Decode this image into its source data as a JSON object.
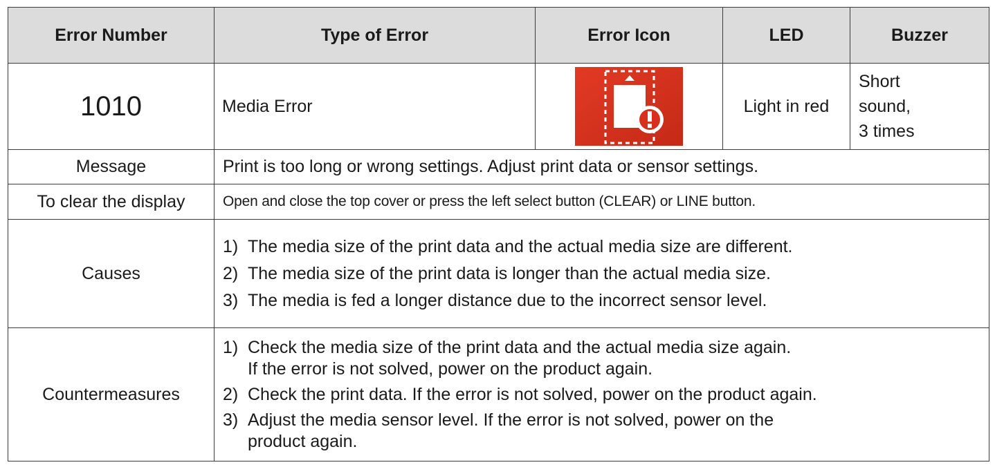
{
  "headers": {
    "error_number": "Error Number",
    "type_of_error": "Type of Error",
    "error_icon": "Error Icon",
    "led": "LED",
    "buzzer": "Buzzer"
  },
  "error": {
    "number": "1010",
    "type": "Media Error",
    "icon": "media-error-icon",
    "led": "Light in red",
    "buzzer_lines": [
      "Short",
      "sound,",
      "3 times"
    ]
  },
  "message": {
    "label": "Message",
    "text": "Print is too long or wrong settings. Adjust print data or sensor settings."
  },
  "clear_display": {
    "label": "To clear the display",
    "text": "Open and close the top cover or press the left select button (CLEAR)  or LINE button."
  },
  "causes": {
    "label": "Causes",
    "items": [
      {
        "num": "1)",
        "lines": [
          "The media size of the print data and the actual media size are different."
        ]
      },
      {
        "num": "2)",
        "lines": [
          "The media size of the print data is longer than the actual media size."
        ]
      },
      {
        "num": "3)",
        "lines": [
          "The media is fed a longer distance due to the incorrect sensor level."
        ]
      }
    ]
  },
  "countermeasures": {
    "label": "Countermeasures",
    "items": [
      {
        "num": "1)",
        "lines": [
          "Check the media size of the print data and the actual media size again.",
          "If the error is not solved, power on the product again."
        ]
      },
      {
        "num": "2)",
        "lines": [
          "Check the print data. If the error is not solved, power on the product again."
        ]
      },
      {
        "num": "3)",
        "lines": [
          "Adjust the media sensor level. If the error is not solved, power on the",
          "product again."
        ]
      }
    ]
  },
  "colors": {
    "header_bg": "#dcdcdc",
    "icon_red": "#d8301d"
  }
}
